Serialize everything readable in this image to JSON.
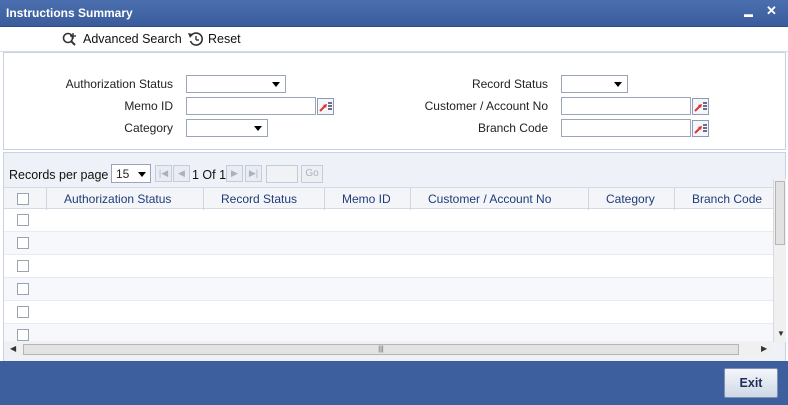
{
  "window": {
    "title": "Instructions Summary",
    "minimize": "▬",
    "close": "✕"
  },
  "toolbar": {
    "advanced_search": "Advanced Search",
    "reset": "Reset"
  },
  "criteria": {
    "authorization_status_label": "Authorization Status",
    "authorization_status_value": "",
    "memo_id_label": "Memo ID",
    "memo_id_value": "",
    "category_label": "Category",
    "category_value": "",
    "record_status_label": "Record Status",
    "record_status_value": "",
    "customer_account_label": "Customer / Account No",
    "customer_account_value": "",
    "branch_code_label": "Branch Code",
    "branch_code_value": ""
  },
  "pager": {
    "records_per_page_label": "Records per page",
    "records_per_page_value": "15",
    "page_info": "1 Of 1",
    "go_label": "Go"
  },
  "table": {
    "columns": [
      "Authorization Status",
      "Record Status",
      "Memo ID",
      "Customer / Account No",
      "Category",
      "Branch Code"
    ],
    "rows": []
  },
  "footer": {
    "exit_label": "Exit"
  },
  "colors": {
    "titlebar": "#3f62a3",
    "footer": "#3e5f9e",
    "header_text": "#1f3c7a"
  }
}
